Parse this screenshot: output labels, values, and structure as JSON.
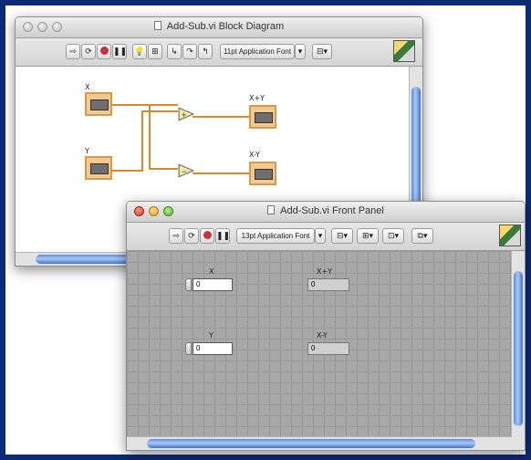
{
  "block_diagram": {
    "title": "Add-Sub.vi Block Diagram",
    "font_selector": "11pt Application Font",
    "labels": {
      "x": "X",
      "y": "Y",
      "sum": "X+Y",
      "diff": "X-Y"
    }
  },
  "front_panel": {
    "title": "Add-Sub.vi Front Panel",
    "font_selector": "13pt Application Font",
    "controls": {
      "x_label": "X",
      "x_value": "0",
      "y_label": "Y",
      "y_value": "0"
    },
    "indicators": {
      "sum_label": "X+Y",
      "sum_value": "0",
      "diff_label": "X-Y",
      "diff_value": "0"
    }
  },
  "colors": {
    "outer_border": "#0d2b73",
    "wire": "#d88a2a",
    "panel_grid": "#a8a8a8",
    "scroll_thumb": "#5b8fe0"
  }
}
